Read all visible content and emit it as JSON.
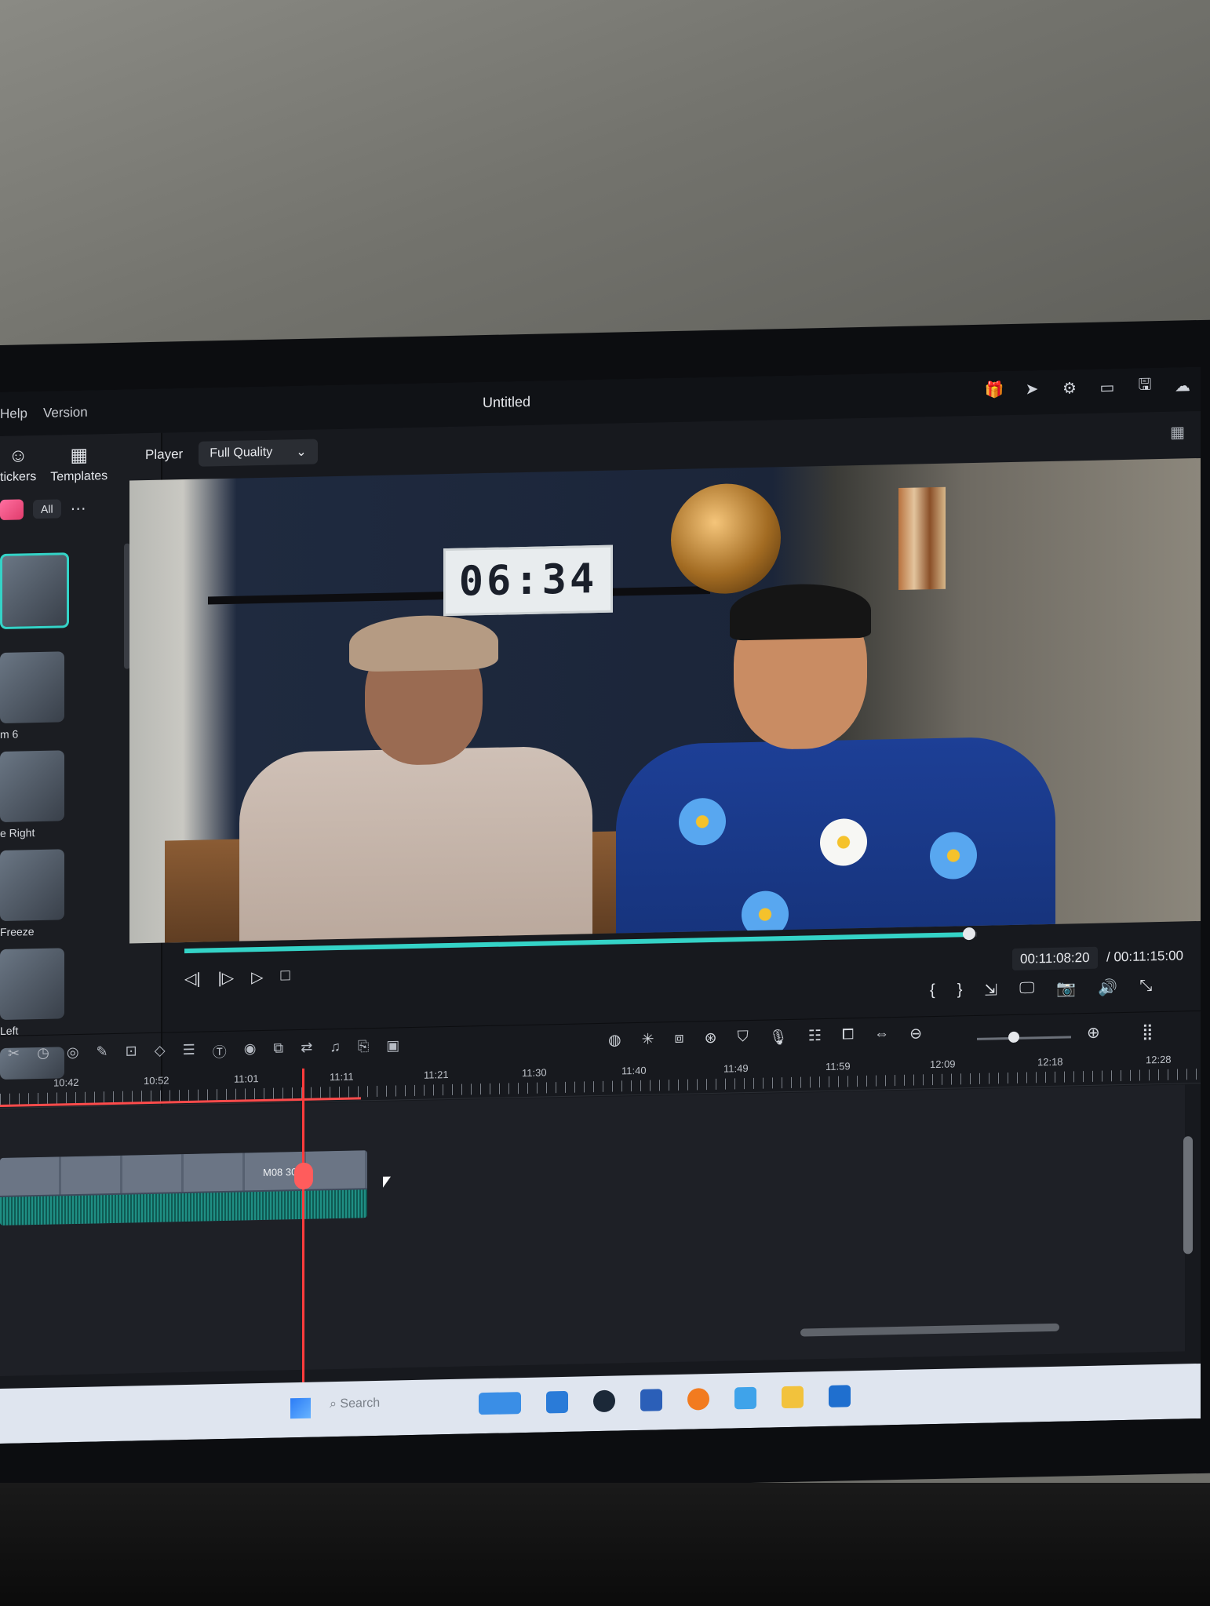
{
  "menu": [
    "Help",
    "Version"
  ],
  "title": "Untitled",
  "title_actions": [
    "gift-icon",
    "send-icon",
    "settings-icon",
    "panel-icon",
    "save-icon",
    "cloud-icon"
  ],
  "left_panel": {
    "tabs": [
      {
        "label": "tickers",
        "icon": "sticker-icon"
      },
      {
        "label": "Templates",
        "icon": "templates-icon"
      }
    ],
    "filter_label": "All",
    "items": [
      "m 6",
      "e Right",
      "Freeze",
      "Left"
    ]
  },
  "player": {
    "label": "Player",
    "quality": "Full Quality",
    "clock_text": "06:34",
    "current_time": "00:11:08:20",
    "total_time": "/ 00:11:15:00",
    "progress": 0.99
  },
  "timeline": {
    "ruler_labels": [
      "10:42",
      "10:52",
      "11:01",
      "11:11",
      "11:21",
      "11:30",
      "11:40",
      "11:49",
      "11:59",
      "12:09",
      "12:18",
      "12:28"
    ],
    "clip_name": "M08 3026"
  },
  "taskbar": {
    "search_placeholder": "Search"
  }
}
